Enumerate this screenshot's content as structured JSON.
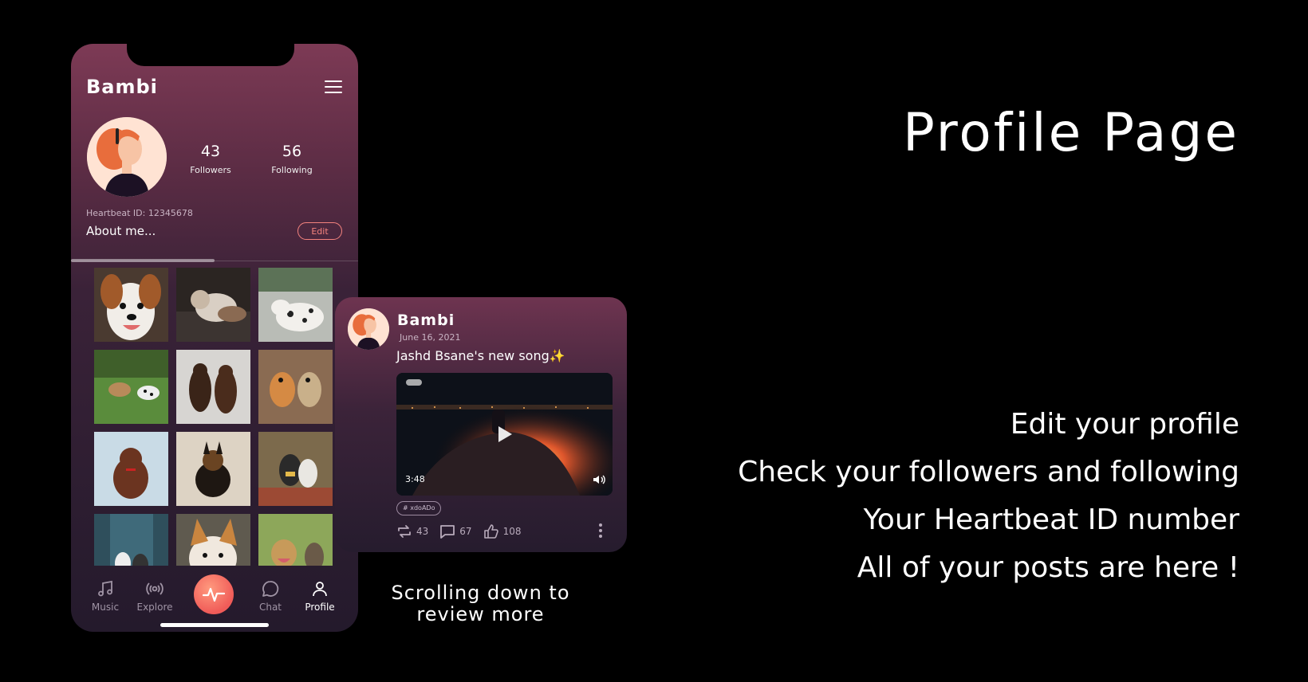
{
  "profile": {
    "username": "Bambi",
    "followers_count": "43",
    "followers_label": "Followers",
    "following_count": "56",
    "following_label": "Following",
    "heartbeat_id": "Heartbeat ID: 12345678",
    "about": "About me...",
    "edit_label": "Edit"
  },
  "bottom_nav": {
    "items": [
      {
        "label": "Music",
        "icon": "music-note-icon"
      },
      {
        "label": "Explore",
        "icon": "broadcast-icon"
      },
      {
        "label": "Chat",
        "icon": "chat-bubble-icon"
      },
      {
        "label": "Profile",
        "icon": "person-icon"
      }
    ],
    "center_icon": "heartbeat-icon",
    "active": "Profile",
    "accent_color": "#f05b58"
  },
  "post": {
    "username": "Bambi",
    "date": "June 16, 2021",
    "text": "Jashd Bsane's new song✨",
    "video_duration": "3:48",
    "tag": "# xdoADo",
    "reposts": "43",
    "comments": "67",
    "likes": "108"
  },
  "caption": {
    "line1": "Scrolling down to",
    "line2": "review more"
  },
  "heading": "Profile Page",
  "features": [
    "Edit your profile",
    "Check your followers and following",
    "Your Heartbeat ID number",
    "All of your posts are here !"
  ]
}
